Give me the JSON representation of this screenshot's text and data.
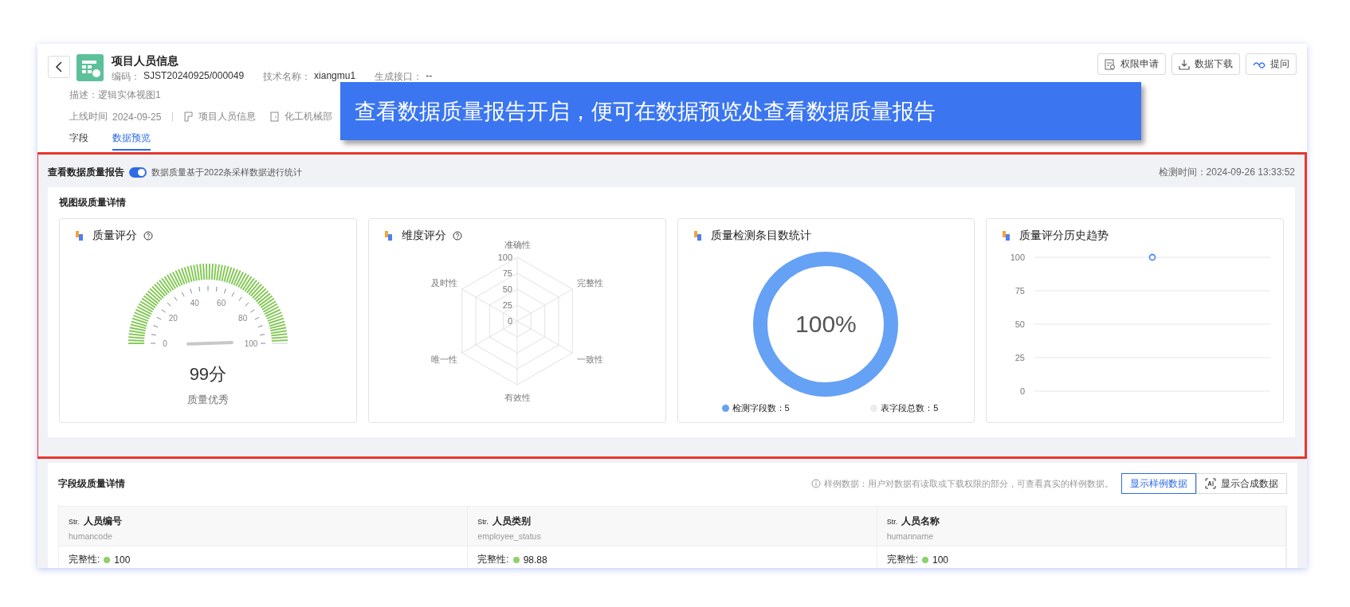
{
  "callout": "查看数据质量报告开启，便可在数据预览处查看数据质量报告",
  "header": {
    "title": "项目人员信息",
    "code_label": "编码：",
    "code": "SJST20240925/000049",
    "tech_label": "技术名称：",
    "tech": "xiangmu1",
    "api_label": "生成接口：",
    "api": "--",
    "description": "描述：逻辑实体视图1",
    "online_label": "上线时间",
    "online": "2024-09-25",
    "tags": [
      {
        "kind": "catalog",
        "label": "项目人员信息"
      },
      {
        "kind": "department",
        "label": "化工机械部"
      }
    ]
  },
  "actions": [
    {
      "kind": "permission",
      "label": "权限申请"
    },
    {
      "kind": "download",
      "label": "数据下载"
    },
    {
      "kind": "ask",
      "label": "提问"
    }
  ],
  "tabs": [
    {
      "label": "字段",
      "selected": false
    },
    {
      "label": "数据预览",
      "selected": true
    }
  ],
  "report": {
    "label": "查看数据质量报告",
    "on": true,
    "note": "数据质量基于2022条采样数据进行统计",
    "check_time": "检测时间：2024-09-26 13:33:52"
  },
  "view_quality": {
    "title": "视图级质量详情",
    "score_card": {
      "title": "质量评分",
      "ticks": [
        "0",
        "20",
        "40",
        "60",
        "80",
        "100"
      ],
      "level": 0.99,
      "score": "99分",
      "grade": "质量优秀"
    },
    "dimension_card": {
      "title": "维度评分",
      "axes": [
        "准确性",
        "完整性",
        "一致性",
        "有效性",
        "唯一性",
        "及时性"
      ],
      "rings": [
        "100",
        "75",
        "50",
        "25",
        "0"
      ]
    },
    "count_card": {
      "title": "质量检测条目数统计",
      "level": 1,
      "percent": "100%",
      "legend": [
        {
          "label": "检测字段数：5",
          "color": "#65a1f5"
        },
        {
          "label": "表字段总数：5",
          "color": "#ececec"
        }
      ]
    },
    "trend_card": {
      "title": "质量评分历史趋势",
      "chart_data": {
        "type": "line",
        "grid": true,
        "marker": true,
        "ylim": [
          0,
          100
        ],
        "yticks": [
          0,
          25,
          50,
          75,
          100
        ],
        "values": [
          100
        ]
      }
    }
  },
  "field_quality": {
    "title": "字段级质量详情",
    "note": "样例数据：用户对数据有读取或下载权限的部分，可查看真实的样例数据。",
    "buttons": [
      {
        "label": "显示样例数据",
        "selected": true
      },
      {
        "label": "显示合成数据",
        "selected": false
      }
    ],
    "columns": [
      {
        "type": "Str.",
        "name": "人员编号",
        "code": "humancode",
        "metric": "完整性:",
        "value": "100"
      },
      {
        "type": "Str.",
        "name": "人员类别",
        "code": "employee_status",
        "metric": "完整性:",
        "value": "98.88"
      },
      {
        "type": "Str.",
        "name": "人员名称",
        "code": "humanname",
        "metric": "完整性:",
        "value": "100"
      }
    ]
  }
}
